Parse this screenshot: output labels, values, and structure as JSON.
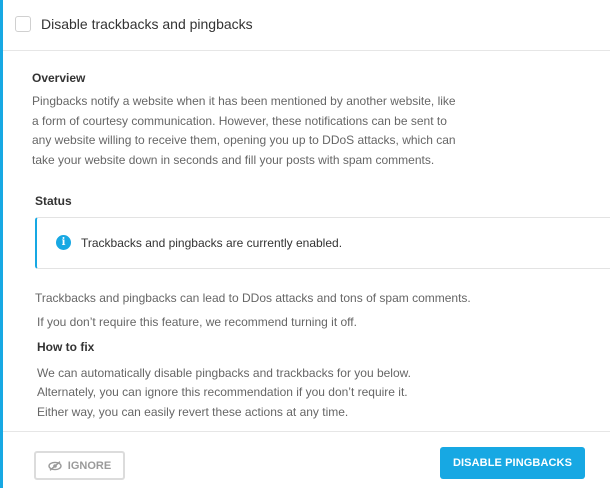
{
  "header": {
    "title": "Disable trackbacks and pingbacks",
    "checked": false
  },
  "overview": {
    "heading": "Overview",
    "text": "Pingbacks notify a website when it has been mentioned by another website, like a form of courtesy communication. However, these notifications can be sent to any website willing to receive them, opening you up to DDoS attacks, which can take your website down in seconds and fill your posts with spam comments."
  },
  "status": {
    "heading": "Status",
    "notice": "Trackbacks and pingbacks are currently enabled.",
    "notice_icon": "info-icon"
  },
  "issue": {
    "line1": "Trackbacks and pingbacks can lead to DDos attacks and tons of spam comments.",
    "line2": "If you don’t require this feature, we recommend turning it off."
  },
  "how_to_fix": {
    "heading": "How to fix",
    "line1": "We can automatically disable pingbacks and trackbacks for you below.",
    "line2": "Alternately, you can ignore this recommendation if you don’t require it.",
    "line3": "Either way, you can easily revert these actions at any time."
  },
  "actions": {
    "ignore_label": "IGNORE",
    "ignore_icon": "eye-slash-icon",
    "disable_label": "DISABLE PINGBACKS"
  },
  "colors": {
    "accent": "#17a8e3",
    "border": "#e6e6e6",
    "muted_text": "#666666"
  }
}
